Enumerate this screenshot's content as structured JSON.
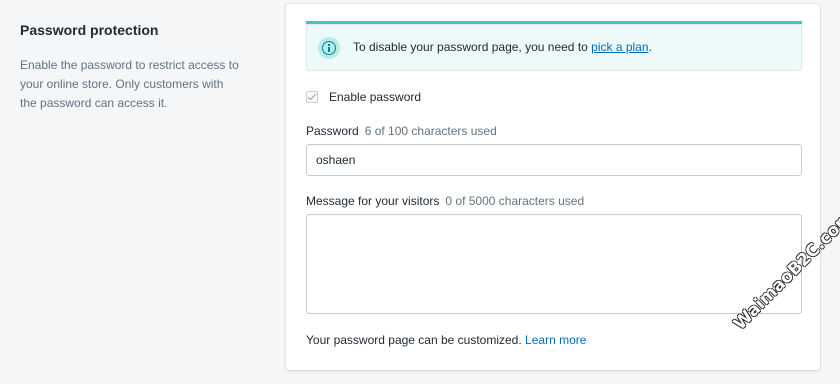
{
  "section": {
    "title": "Password protection",
    "description": "Enable the password to restrict access to your online store. Only customers with the password can access it."
  },
  "banner": {
    "text_before": "To disable your password page, you need to ",
    "link": "pick a plan",
    "text_after": ".",
    "icon": "info-icon"
  },
  "enable_password": {
    "label": "Enable password",
    "checked": true
  },
  "password_field": {
    "label": "Password",
    "hint": "6 of 100 characters used",
    "value": "oshaen"
  },
  "message_field": {
    "label": "Message for your visitors",
    "hint": "0 of 5000 characters used",
    "value": ""
  },
  "footer": {
    "text": "Your password page can be customized.",
    "link": "Learn more"
  },
  "watermark": "WaimaoB2C.com",
  "colors": {
    "accent": "#47c1bf",
    "link": "#006fbb",
    "banner_bg": "#eef9f9",
    "page_bg": "#f4f6f8"
  }
}
